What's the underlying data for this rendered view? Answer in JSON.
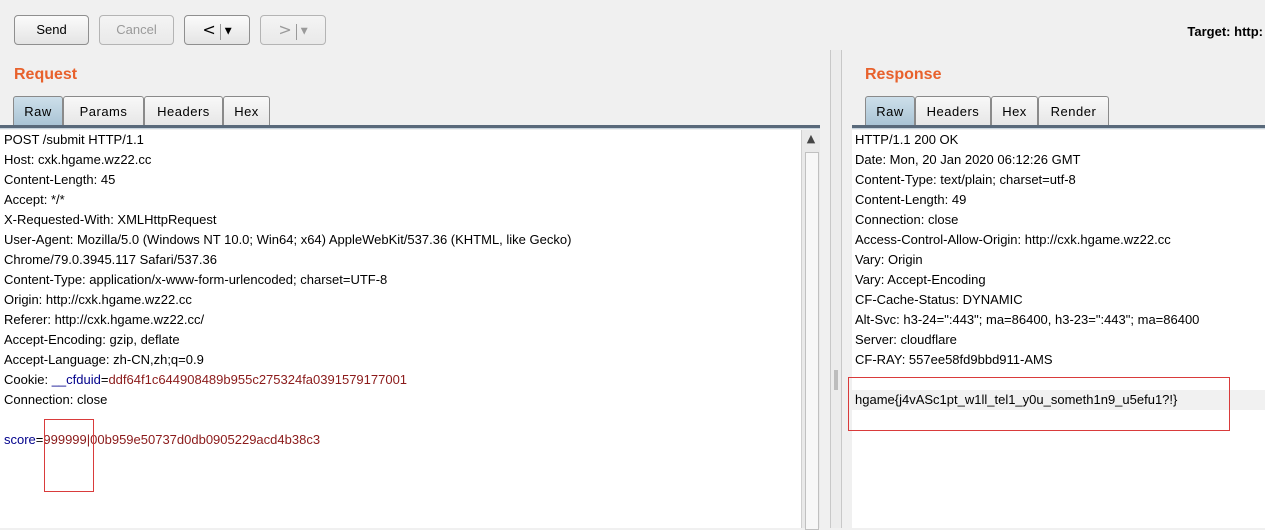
{
  "toolbar": {
    "send_label": "Send",
    "cancel_label": "Cancel",
    "back_icon": "chevron-left",
    "forward_icon": "chevron-right",
    "dropdown_icon": "triangle-down",
    "target_label": "Target: http:"
  },
  "request": {
    "title": "Request",
    "tabs": [
      "Raw",
      "Params",
      "Headers",
      "Hex"
    ],
    "active_tab": "Raw",
    "lines": [
      "POST /submit HTTP/1.1",
      "Host: cxk.hgame.wz22.cc",
      "Content-Length: 45",
      "Accept: */*",
      "X-Requested-With: XMLHttpRequest",
      "User-Agent: Mozilla/5.0 (Windows NT 10.0; Win64; x64) AppleWebKit/537.36 (KHTML, like Gecko)",
      "Chrome/79.0.3945.117 Safari/537.36",
      "Content-Type: application/x-www-form-urlencoded; charset=UTF-8",
      "Origin: http://cxk.hgame.wz22.cc",
      "Referer: http://cxk.hgame.wz22.cc/",
      "Accept-Encoding: gzip, deflate",
      "Accept-Language: zh-CN,zh;q=0.9"
    ],
    "cookie": {
      "prefix": "Cookie: ",
      "name": "__cfduid",
      "eq": "=",
      "value": "ddf64f1c644908489b955c275324fa0391579177001"
    },
    "connection_line": "Connection: close",
    "body": {
      "name": "score",
      "eq": "=",
      "value": "999999|00b959e50737d0db0905229acd4b38c3"
    }
  },
  "response": {
    "title": "Response",
    "tabs": [
      "Raw",
      "Headers",
      "Hex",
      "Render"
    ],
    "active_tab": "Raw",
    "lines": [
      "HTTP/1.1 200 OK",
      "Date: Mon, 20 Jan 2020 06:12:26 GMT",
      "Content-Type: text/plain; charset=utf-8",
      "Content-Length: 49",
      "Connection: close",
      "Access-Control-Allow-Origin: http://cxk.hgame.wz22.cc",
      "Vary: Origin",
      "Vary: Accept-Encoding",
      "CF-Cache-Status: DYNAMIC",
      "Alt-Svc: h3-24=\":443\"; ma=86400, h3-23=\":443\"; ma=86400",
      "Server: cloudflare",
      "CF-RAY: 557ee58fd9bbd911-AMS"
    ],
    "body": "hgame{j4vASc1pt_w1ll_tel1_y0u_someth1n9_u5efu1?!}"
  },
  "colors": {
    "accent": "#e8612c",
    "annotation": "#d93b3b",
    "param_name": "#00008b",
    "param_value": "#8b1a1a"
  }
}
